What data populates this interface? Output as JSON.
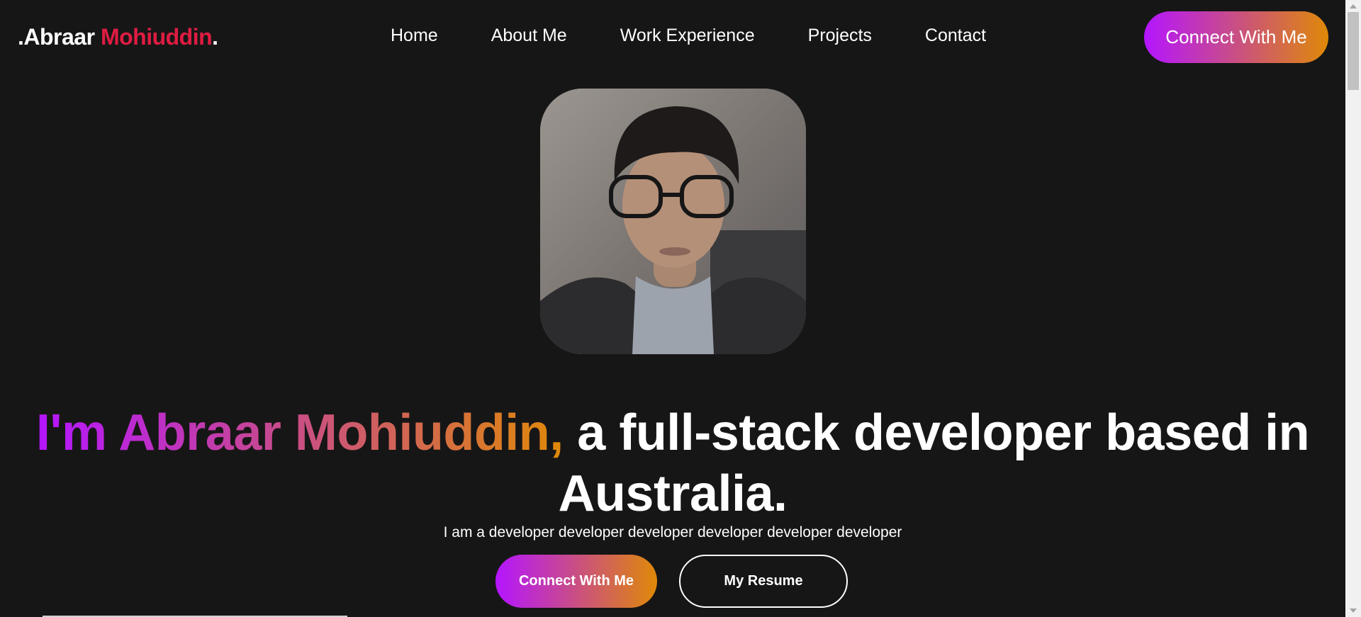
{
  "brand": {
    "prefix": ".Abraar",
    "accent": "Mohiuddin",
    "suffix": "."
  },
  "nav": {
    "items": [
      {
        "label": "Home"
      },
      {
        "label": "About Me"
      },
      {
        "label": "Work Experience"
      },
      {
        "label": "Projects"
      },
      {
        "label": "Contact"
      }
    ],
    "cta_label": "Connect With Me"
  },
  "hero": {
    "image_alt": "Abraar Mohiuddin",
    "headline_highlight": "I'm Abraar Mohiuddin,",
    "headline_rest": "a full-stack developer based in Australia.",
    "subtitle": "I am a developer developer developer developer developer developer",
    "primary_button": "Connect With Me",
    "secondary_button": "My Resume"
  },
  "colors": {
    "background": "#171616",
    "brand_accent": "#df1c42",
    "gradient_start": "#b415ff",
    "gradient_end": "#df8908"
  }
}
